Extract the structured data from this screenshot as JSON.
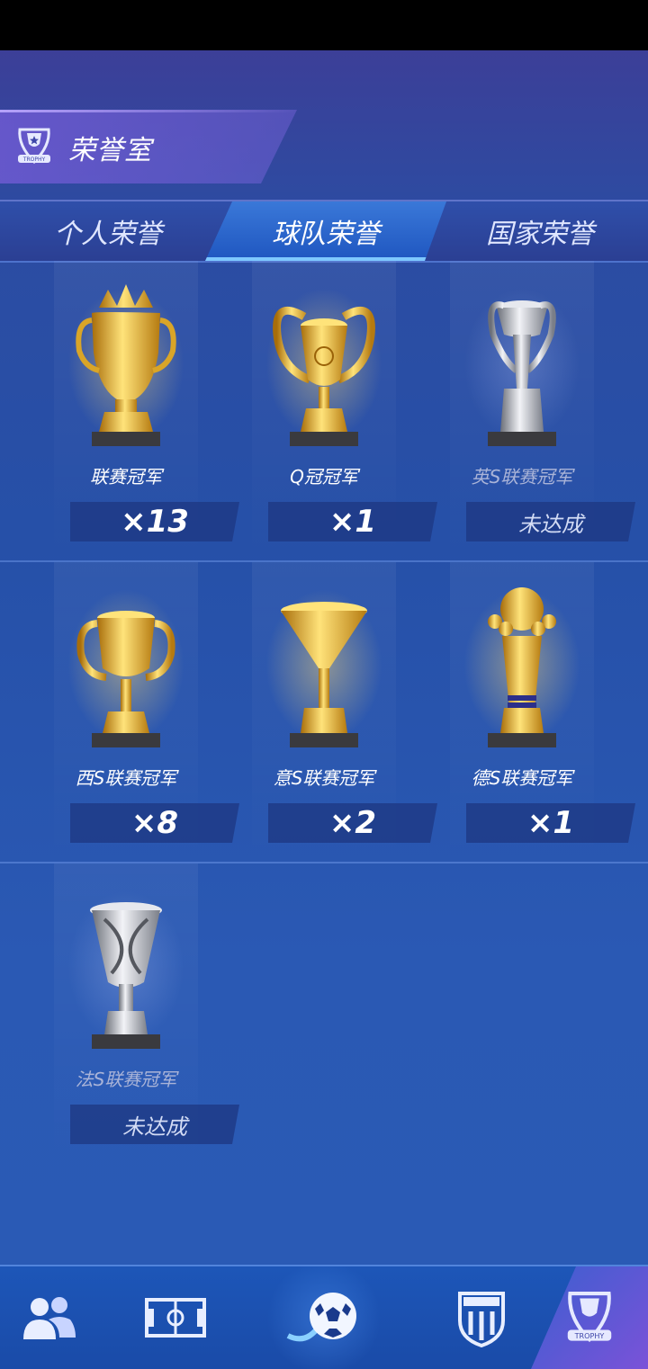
{
  "header": {
    "title": "荣誉室",
    "trophy_badge_text": "TROPHY"
  },
  "tabs": [
    {
      "label": "个人荣誉",
      "active": false
    },
    {
      "label": "球队荣誉",
      "active": true
    },
    {
      "label": "国家荣誉",
      "active": false
    }
  ],
  "trophies": [
    {
      "name": "联赛冠军",
      "count": "×13",
      "achieved": true,
      "icon": "gold-crown-trophy-icon"
    },
    {
      "name": "Q冠冠军",
      "count": "×1",
      "achieved": true,
      "icon": "gold-big-ears-cup-icon"
    },
    {
      "name": "英S联赛冠军",
      "count": "未达成",
      "achieved": false,
      "icon": "silver-winged-trophy-icon"
    },
    {
      "name": "西S联赛冠军",
      "count": "×8",
      "achieved": true,
      "icon": "gold-handled-cup-icon"
    },
    {
      "name": "意S联赛冠军",
      "count": "×2",
      "achieved": true,
      "icon": "gold-funnel-cup-icon"
    },
    {
      "name": "德S联赛冠军",
      "count": "×1",
      "achieved": true,
      "icon": "gold-ball-trophy-icon"
    },
    {
      "name": "法S联赛冠军",
      "count": "未达成",
      "achieved": false,
      "icon": "silver-twisted-cup-icon"
    }
  ],
  "bottom_nav": [
    {
      "name": "players-icon",
      "active": false
    },
    {
      "name": "pitch-icon",
      "active": false
    },
    {
      "name": "soccer-ball-icon",
      "active": false
    },
    {
      "name": "club-badge-icon",
      "active": false
    },
    {
      "name": "trophy-badge-icon",
      "active": true
    }
  ],
  "colors": {
    "accent": "#7ec8ff",
    "gold": "#f2c230",
    "silver": "#c8ccd8"
  }
}
